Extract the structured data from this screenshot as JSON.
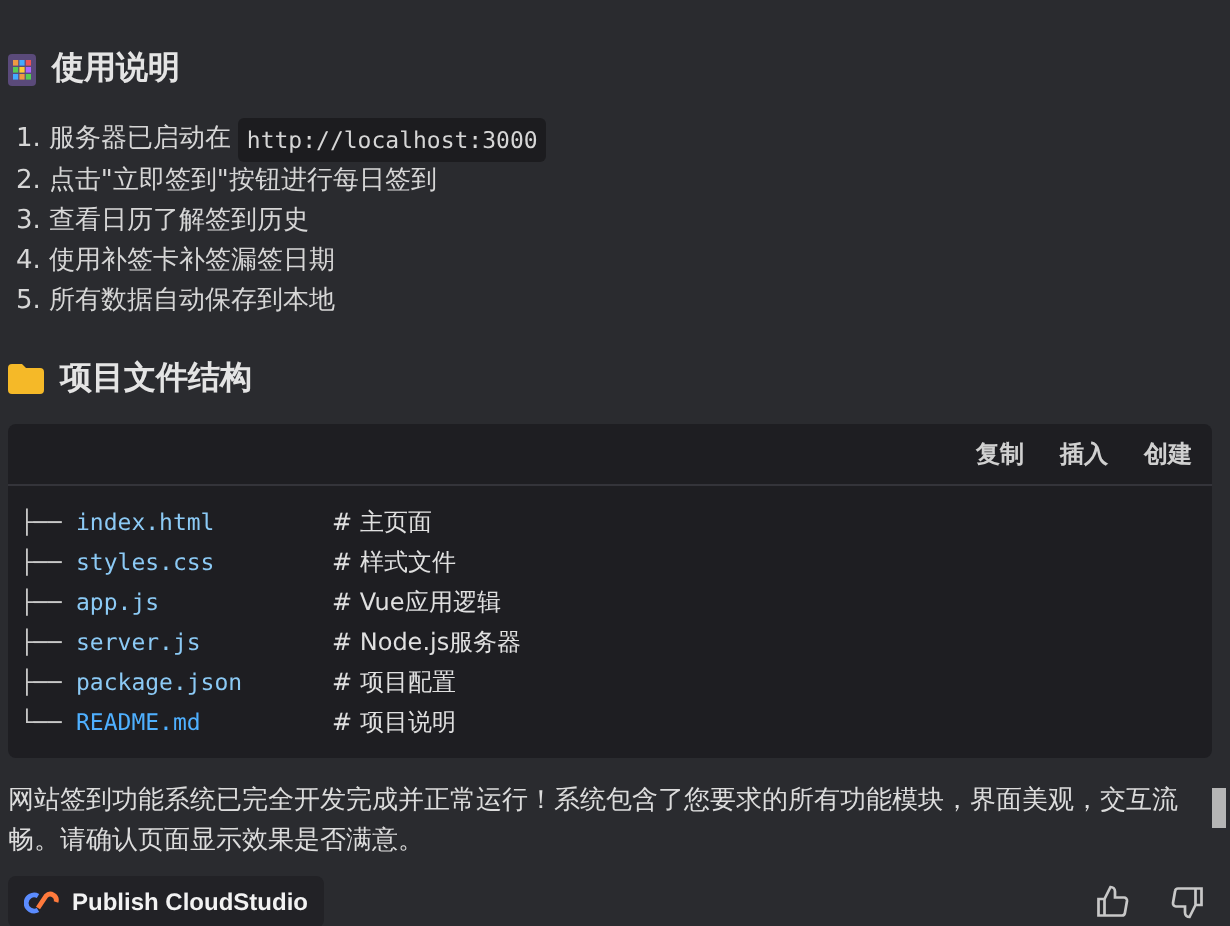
{
  "usage": {
    "title": "使用说明",
    "steps": [
      {
        "number": "1.",
        "text": "服务器已启动在",
        "code": "http://localhost:3000"
      },
      {
        "number": "2.",
        "text": "点击\"立即签到\"按钮进行每日签到"
      },
      {
        "number": "3.",
        "text": "查看日历了解签到历史"
      },
      {
        "number": "4.",
        "text": "使用补签卡补签漏签日期"
      },
      {
        "number": "5.",
        "text": "所有数据自动保存到本地"
      }
    ]
  },
  "structure": {
    "title": "项目文件结构",
    "actions": [
      "复制",
      "插入",
      "创建"
    ],
    "files": [
      {
        "tree": "├──",
        "name": "index.html",
        "comment": "# 主页面"
      },
      {
        "tree": "├──",
        "name": "styles.css",
        "comment": "# 样式文件"
      },
      {
        "tree": "├──",
        "name": "app.js",
        "comment": "# Vue应用逻辑"
      },
      {
        "tree": "├──",
        "name": "server.js",
        "comment": "# Node.js服务器"
      },
      {
        "tree": "├──",
        "name": "package.json",
        "comment": "# 项目配置"
      },
      {
        "tree": "└──",
        "name": "README.md",
        "comment": "# 项目说明"
      }
    ]
  },
  "message": "网站签到功能系统已完全开发完成并正常运行！系统包含了您要求的所有功能模块，界面美观，交互流畅。请确认页面显示效果是否满意。",
  "publish_button": "Publish CloudStudio"
}
